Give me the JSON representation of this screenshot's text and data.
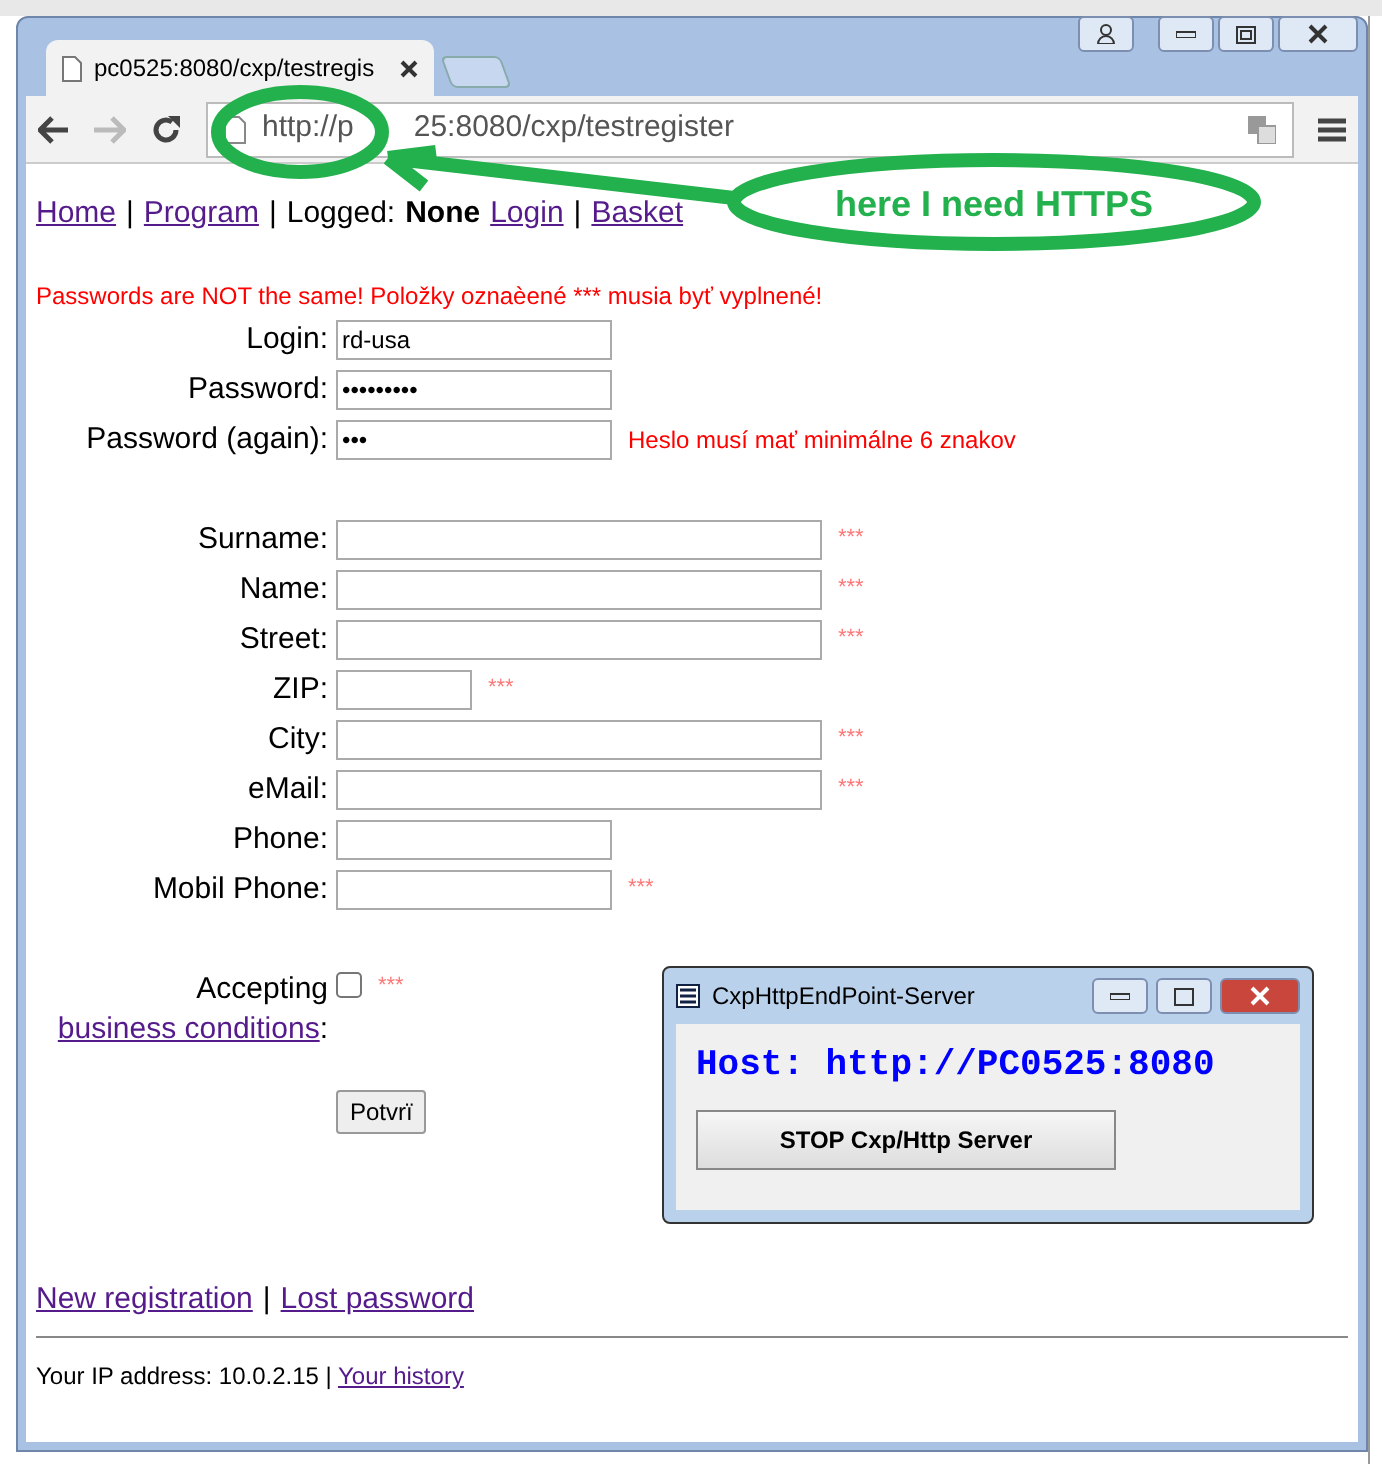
{
  "browser": {
    "tab_title": "pc0525:8080/cxp/testregis",
    "url_parts": [
      "http://p",
      "25:8080/cxp/testregister"
    ]
  },
  "annotation": {
    "text": "here I need HTTPS"
  },
  "nav": [
    {
      "kind": "link",
      "text": "Home"
    },
    {
      "kind": "sep",
      "text": "|"
    },
    {
      "kind": "link",
      "text": "Program"
    },
    {
      "kind": "sep",
      "text": "|"
    },
    {
      "kind": "text",
      "text": "Logged:"
    },
    {
      "kind": "bold",
      "text": "None"
    },
    {
      "kind": "link",
      "text": "Login"
    },
    {
      "kind": "sep",
      "text": "|"
    },
    {
      "kind": "link",
      "text": "Basket"
    }
  ],
  "error": "Passwords are NOT the same! Položky oznaèené *** musia byť vyplnené!",
  "account_fields": [
    {
      "label": "Login:",
      "value": "rd-usa",
      "kind": "medium",
      "required": false
    },
    {
      "label": "Password:",
      "value": "•••••••••",
      "kind": "medium",
      "required": false
    },
    {
      "label": "Password (again):",
      "value": "•••",
      "kind": "medium",
      "required": false,
      "note": "Heslo musí mať minimálne 6 znakov"
    }
  ],
  "required_mark": "***",
  "address_fields": [
    {
      "label": "Surname:",
      "kind": "long",
      "required": true
    },
    {
      "label": "Name:",
      "kind": "long",
      "required": true
    },
    {
      "label": "Street:",
      "kind": "long",
      "required": true
    },
    {
      "label": "ZIP:",
      "kind": "short",
      "required": true
    },
    {
      "label": "City:",
      "kind": "long",
      "required": true
    },
    {
      "label": "eMail:",
      "kind": "long",
      "required": true
    },
    {
      "label": "Phone:",
      "kind": "medium",
      "required": false
    },
    {
      "label": "Mobil Phone:",
      "kind": "medium",
      "required": true
    }
  ],
  "accept": {
    "text": "Accepting",
    "link": "business conditions",
    "suffix": ":",
    "checked": false,
    "required": true
  },
  "submit": "Potvrï",
  "links": [
    {
      "kind": "link",
      "text": "New registration"
    },
    {
      "kind": "sep",
      "text": "|"
    },
    {
      "kind": "link",
      "text": "Lost password"
    }
  ],
  "footer": {
    "text": "Your IP address: 10.0.2.15 |",
    "link": "Your history"
  },
  "popup": {
    "title": "CxpHttpEndPoint-Server",
    "host": "Host: http://PC0525:8080",
    "button": "STOP Cxp/Http Server"
  }
}
